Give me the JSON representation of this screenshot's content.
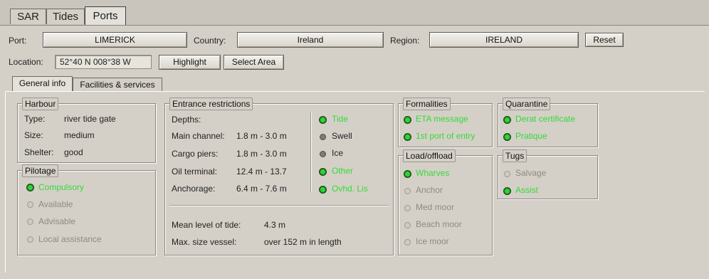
{
  "tabs": {
    "sar": "SAR",
    "tides": "Tides",
    "ports": "Ports"
  },
  "port_row": {
    "port_label": "Port:",
    "port_value": "LIMERICK",
    "country_label": "Country:",
    "country_value": "Ireland",
    "region_label": "Region:",
    "region_value": "IRELAND",
    "reset": "Reset"
  },
  "location_row": {
    "label": "Location:",
    "value": "52°40 N  008°38 W",
    "highlight": "Highlight",
    "select_area": "Select Area"
  },
  "subtabs": {
    "general": "General info",
    "facilities": "Facilities & services"
  },
  "harbour": {
    "title": "Harbour",
    "type_label": "Type:",
    "type_value": "river tide gate",
    "size_label": "Size:",
    "size_value": "medium",
    "shelter_label": "Shelter:",
    "shelter_value": "good"
  },
  "pilotage": {
    "title": "Pilotage",
    "items": [
      {
        "label": "Compulsory",
        "state": "on"
      },
      {
        "label": "Available",
        "state": "off"
      },
      {
        "label": "Advisable",
        "state": "off"
      },
      {
        "label": "Local assistance",
        "state": "off"
      }
    ]
  },
  "entrance": {
    "title": "Entrance restrictions",
    "depths_label": "Depths:",
    "main_channel_label": "Main channel:",
    "main_channel_value": "1.8 m - 3.0 m",
    "cargo_label": "Cargo piers:",
    "cargo_value": "1.8 m - 3.0 m",
    "oil_label": "Oil terminal:",
    "oil_value": "12.4 m - 13.7",
    "anchorage_label": "Anchorage:",
    "anchorage_value": "6.4 m - 7.6 m",
    "restrictions": [
      {
        "label": "Tide",
        "state": "on"
      },
      {
        "label": "Swell",
        "state": "gray"
      },
      {
        "label": "Ice",
        "state": "gray"
      },
      {
        "label": "Other",
        "state": "on"
      },
      {
        "label": "Ovhd. Lis",
        "state": "on"
      }
    ],
    "tide_label": "Mean level of tide:",
    "tide_value": "4.3 m",
    "vessel_label": "Max. size vessel:",
    "vessel_value": "over 152 m in length"
  },
  "formalities": {
    "title": "Formalities",
    "items": [
      {
        "label": "ETA message",
        "state": "on"
      },
      {
        "label": "1st port of entry",
        "state": "on"
      }
    ]
  },
  "loadoffload": {
    "title": "Load/offload",
    "items": [
      {
        "label": "Wharves",
        "state": "on"
      },
      {
        "label": "Anchor",
        "state": "off"
      },
      {
        "label": "Med moor",
        "state": "off"
      },
      {
        "label": "Beach moor",
        "state": "off"
      },
      {
        "label": "Ice moor",
        "state": "off"
      }
    ]
  },
  "quarantine": {
    "title": "Quarantine",
    "items": [
      {
        "label": "Derat certificate",
        "state": "on"
      },
      {
        "label": "Pratique",
        "state": "on"
      }
    ]
  },
  "tugs": {
    "title": "Tugs",
    "items": [
      {
        "label": "Salvage",
        "state": "off"
      },
      {
        "label": "Assist",
        "state": "on"
      }
    ]
  }
}
